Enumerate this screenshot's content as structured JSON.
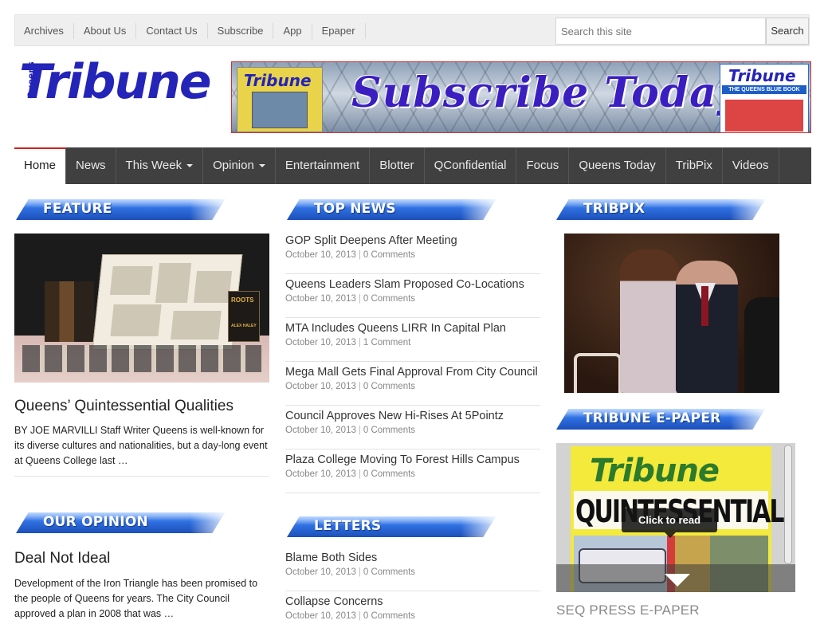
{
  "topnav": {
    "items": [
      "Archives",
      "About Us",
      "Contact Us",
      "Subscribe",
      "App",
      "Epaper"
    ]
  },
  "search": {
    "placeholder": "Search this site",
    "button_label": "Search"
  },
  "logo": {
    "main": "Tribune",
    "sub": "Queens"
  },
  "banner": {
    "text": "Subscribe Today",
    "left_magazine_title": "Tribune",
    "right_magazine_title": "Tribune",
    "right_magazine_subtitle": "THE QUEENS BLUE BOOK"
  },
  "mainnav": {
    "items": [
      {
        "label": "Home",
        "active": true
      },
      {
        "label": "News"
      },
      {
        "label": "This Week",
        "dropdown": true
      },
      {
        "label": "Opinion",
        "dropdown": true
      },
      {
        "label": "Entertainment"
      },
      {
        "label": "Blotter"
      },
      {
        "label": "QConfidential"
      },
      {
        "label": "Focus"
      },
      {
        "label": "Queens Today"
      },
      {
        "label": "TribPix"
      },
      {
        "label": "Videos"
      }
    ]
  },
  "sections": {
    "feature": "FEATURE",
    "top_news": "TOP NEWS",
    "tribpix": "TRIBPIX",
    "our_opinion": "OUR OPINION",
    "letters": "LETTERS",
    "epaper": "TRIBUNE E-PAPER"
  },
  "feature": {
    "title": "Queens’ Quintessential Qualities",
    "excerpt": "BY JOE MARVILLI Staff Writer Queens is well-known for its diverse cultures and nationalities, but a day-long event at Queens College last …",
    "image_book_label": "ROOTS",
    "image_book_author": "ALEX HALEY"
  },
  "opinion": {
    "title": "Deal Not Ideal",
    "excerpt": "Development of the Iron Triangle has been promised to the people of Queens for years. The City Council approved a plan in 2008 that was …"
  },
  "top_news": [
    {
      "title": "GOP Split Deepens After Meeting",
      "date": "October 10, 2013",
      "comments": "0 Comments"
    },
    {
      "title": "Queens Leaders Slam Proposed Co-Locations",
      "date": "October 10, 2013",
      "comments": "0 Comments"
    },
    {
      "title": "MTA Includes Queens LIRR In Capital Plan",
      "date": "October 10, 2013",
      "comments": "1 Comment"
    },
    {
      "title": "Mega Mall Gets Final Approval From City Council",
      "date": "October 10, 2013",
      "comments": "0 Comments"
    },
    {
      "title": "Council Approves New Hi-Rises At 5Pointz",
      "date": "October 10, 2013",
      "comments": "0 Comments"
    },
    {
      "title": "Plaza College Moving To Forest Hills Campus",
      "date": "October 10, 2013",
      "comments": "0 Comments"
    }
  ],
  "letters": [
    {
      "title": "Blame Both Sides",
      "date": "October 10, 2013",
      "comments": "0 Comments"
    },
    {
      "title": "Collapse Concerns",
      "date": "October 10, 2013",
      "comments": "0 Comments"
    }
  ],
  "epaper": {
    "logo": "Tribune",
    "headline": "QUINTESSENTIAL!",
    "click_label": "Click to read",
    "seq_title": "SEQ PRESS E-PAPER"
  },
  "colors": {
    "nav_bg": "#404040",
    "nav_active_border": "#cc2222",
    "ribbon_blue": "#2f6fe0",
    "logo_blue": "#2424b8"
  }
}
